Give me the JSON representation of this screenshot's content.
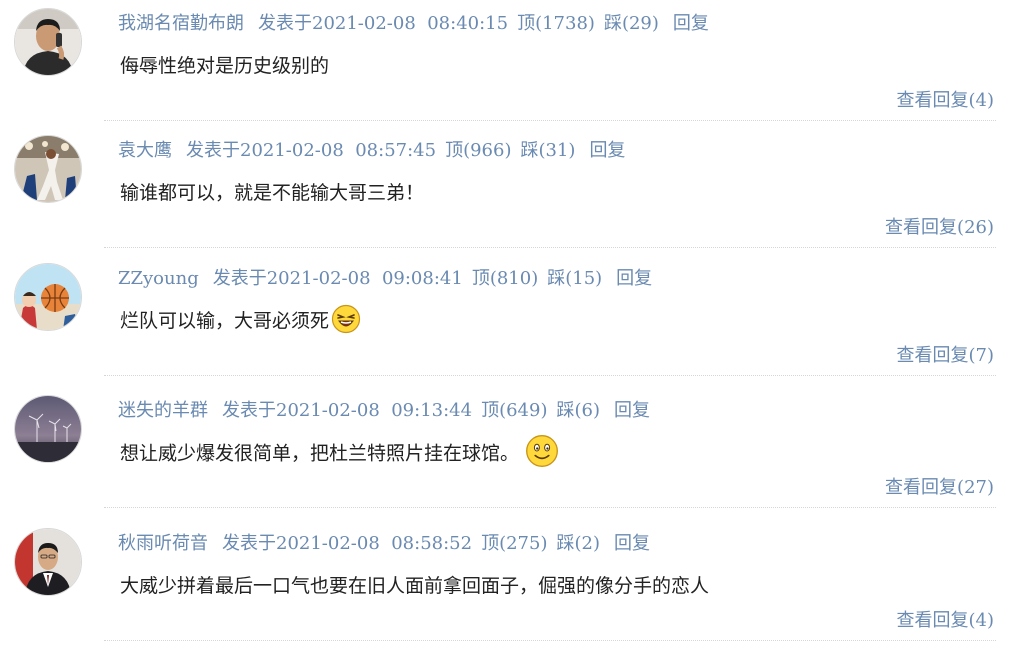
{
  "comments": [
    {
      "author": "我湖名宿勤布朗",
      "posted_label": "发表于",
      "timestamp": "2021-02-08  08:40:15",
      "up_label": "顶",
      "up_count": "(1738)",
      "down_label": "踩",
      "down_count": "(29)",
      "reply_label": "回复",
      "text": "侮辱性绝对是历史级别的",
      "view_replies": "查看回复(4)",
      "emoji": null,
      "avatar_icon": "man-on-phone-avatar"
    },
    {
      "author": "袁大鹰",
      "posted_label": "发表于",
      "timestamp": "2021-02-08  08:57:45",
      "up_label": "顶",
      "up_count": "(966)",
      "down_label": "踩",
      "down_count": "(31)",
      "reply_label": "回复",
      "text": "输谁都可以，就是不能输大哥三弟！",
      "view_replies": "查看回复(26)",
      "emoji": null,
      "avatar_icon": "basketball-dunk-avatar"
    },
    {
      "author": "ZZyoung",
      "posted_label": "发表于",
      "timestamp": "2021-02-08  09:08:41",
      "up_label": "顶",
      "up_count": "(810)",
      "down_label": "踩",
      "down_count": "(15)",
      "reply_label": "回复",
      "text": "烂队可以输，大哥必须死",
      "view_replies": "查看回复(7)",
      "emoji": "laughing-face-icon",
      "avatar_icon": "anime-basketball-avatar"
    },
    {
      "author": "迷失的羊群",
      "posted_label": "发表于",
      "timestamp": "2021-02-08  09:13:44",
      "up_label": "顶",
      "up_count": "(649)",
      "down_label": "踩",
      "down_count": "(6)",
      "reply_label": "回复",
      "text": "想让威少爆发很简单，把杜兰特照片挂在球馆。",
      "view_replies": "查看回复(27)",
      "emoji": "smiling-face-icon",
      "avatar_icon": "wind-turbines-avatar"
    },
    {
      "author": "秋雨听荷音",
      "posted_label": "发表于",
      "timestamp": "2021-02-08  08:58:52",
      "up_label": "顶",
      "up_count": "(275)",
      "down_label": "踩",
      "down_count": "(2)",
      "reply_label": "回复",
      "text": "大威少拼着最后一口气也要在旧人面前拿回面子，倔强的像分手的恋人",
      "view_replies": "查看回复(4)",
      "emoji": null,
      "avatar_icon": "man-in-suit-avatar"
    }
  ],
  "colors": {
    "link": "#6a8ab1",
    "text": "#222222",
    "divider": "#d6d6d6"
  }
}
